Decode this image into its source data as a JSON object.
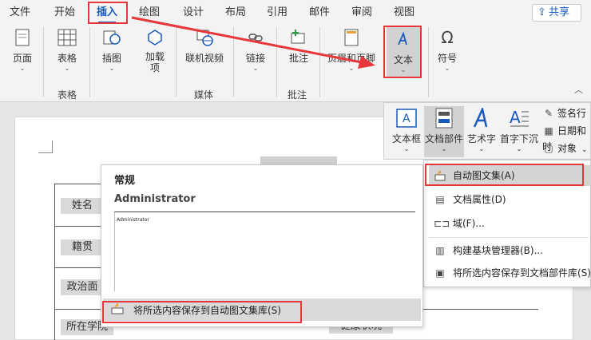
{
  "tabs": [
    "文件",
    "开始",
    "插入",
    "绘图",
    "设计",
    "布局",
    "引用",
    "邮件",
    "审阅",
    "视图"
  ],
  "active_tab": "插入",
  "share_label": "共享",
  "ribbon": {
    "page": "页面",
    "table": "表格",
    "picture": "插图",
    "addins": "加载项",
    "online_video": "联机视频",
    "link": "链接",
    "comment": "批注",
    "header_footer": "页眉和页脚",
    "text": "文本",
    "symbol": "符号",
    "group_table": "表格",
    "group_media": "媒体",
    "group_comment": "批注"
  },
  "text_panel": {
    "textbox": "文本框",
    "quickparts": "文档部件",
    "wordart": "艺术字",
    "dropcap": "首字下沉",
    "signature": "签名行",
    "datetime": "日期和时",
    "object": "对象"
  },
  "quickparts_menu": [
    {
      "label": "自动图文集(A)",
      "icon": "autotext-icon"
    },
    {
      "label": "文档属性(D)",
      "icon": "doc-property-icon"
    },
    {
      "label": "域(F)...",
      "icon": "field-icon"
    },
    {
      "label": "构建基块管理器(B)...",
      "icon": "building-blocks-icon"
    },
    {
      "label": "将所选内容保存到文档部件库(S)...",
      "icon": "save-gallery-icon"
    }
  ],
  "autotext_menu": {
    "category": "常规",
    "entry_name": "Administrator",
    "preview_text": "Administrator",
    "save_label": "将所选内容保存到自动图文集库(S)"
  },
  "document": {
    "labels": [
      "姓名",
      "籍贯",
      "政治面",
      "所在学院",
      "健康状况"
    ]
  },
  "colors": {
    "accent": "#185abd",
    "annotation": "#e8373a"
  }
}
